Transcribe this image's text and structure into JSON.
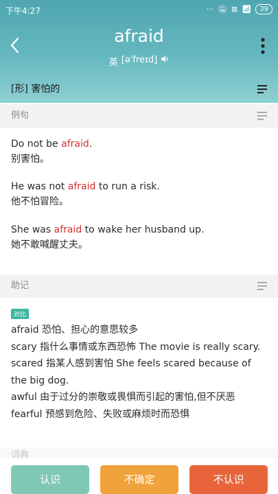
{
  "status": {
    "time": "下午4:27",
    "battery": "39"
  },
  "word": "afraid",
  "phonetic": {
    "region": "英",
    "ipa": "[əˈfreɪd]"
  },
  "meaning": "[形] 害怕的",
  "sections": {
    "examples": "例句",
    "mnemonic": "助记",
    "dictionary": "词典"
  },
  "examples": [
    {
      "before": "Do not be ",
      "hl": "afraid",
      "after": ".",
      "cn": "别害怕。"
    },
    {
      "before": "He was not ",
      "hl": "afraid",
      "after": " to run a risk.",
      "cn": "他不怕冒险。"
    },
    {
      "before": "She was ",
      "hl": "afraid",
      "after": " to wake her husband up.",
      "cn": "她不敢喊醒丈夫。"
    }
  ],
  "mnemonic_tag": "对比",
  "mnemonic_lines": [
    "afraid   恐怕、担心的意思较多",
    "scary   指什么事情或东西恐怖   The movie is really scary.",
    "scared 指某人感到害怕   She feels scared  because of the big dog.",
    "awful   由于过分的崇敬或畏惧而引起的害怕,但不厌恶",
    "fearful  预感到危险、失败或麻烦时而恐惧"
  ],
  "buttons": {
    "know": "认识",
    "unsure": "不确定",
    "unknown": "不认识"
  },
  "icons": {
    "back": "chevron-left-icon",
    "more": "more-vertical-icon",
    "speaker": "speaker-icon",
    "filter": "filter-lines-icon"
  }
}
